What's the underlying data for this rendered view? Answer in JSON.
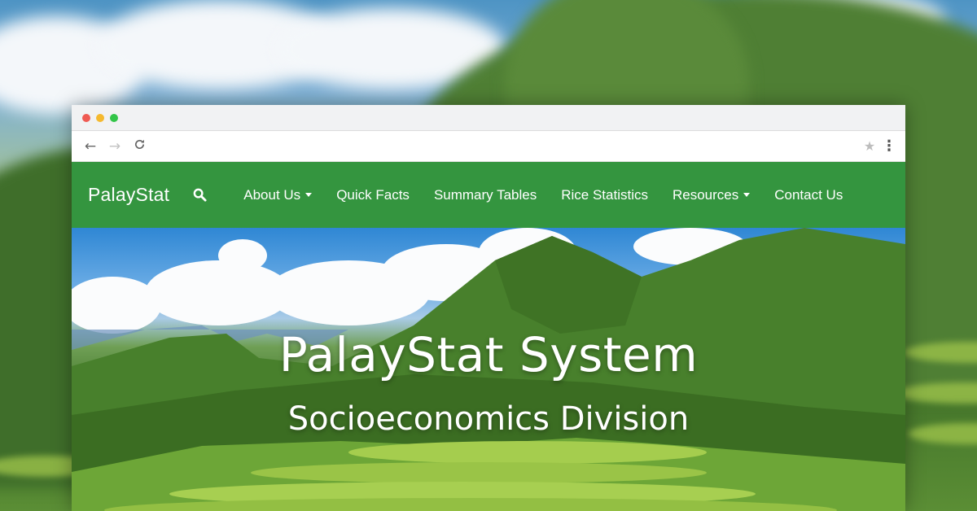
{
  "site": {
    "brand": "PalayStat"
  },
  "nav": {
    "items": [
      {
        "label": "About Us",
        "dropdown": true
      },
      {
        "label": "Quick Facts",
        "dropdown": false
      },
      {
        "label": "Summary Tables",
        "dropdown": false
      },
      {
        "label": "Rice Statistics",
        "dropdown": false
      },
      {
        "label": "Resources",
        "dropdown": true
      },
      {
        "label": "Contact Us",
        "dropdown": false
      }
    ]
  },
  "hero": {
    "title": "PalayStat System",
    "subtitle": "Socioeconomics Division"
  },
  "browser": {
    "url_value": "",
    "icons": {
      "back": "back-arrow-icon",
      "forward": "forward-arrow-icon",
      "reload": "reload-icon",
      "bookmark": "star-icon",
      "menu": "kebab-menu-icon",
      "search": "search-icon"
    }
  },
  "colors": {
    "navbar": "#34953f",
    "dot_close": "#ef5a52",
    "dot_min": "#f5b92e",
    "dot_max": "#33c548"
  }
}
